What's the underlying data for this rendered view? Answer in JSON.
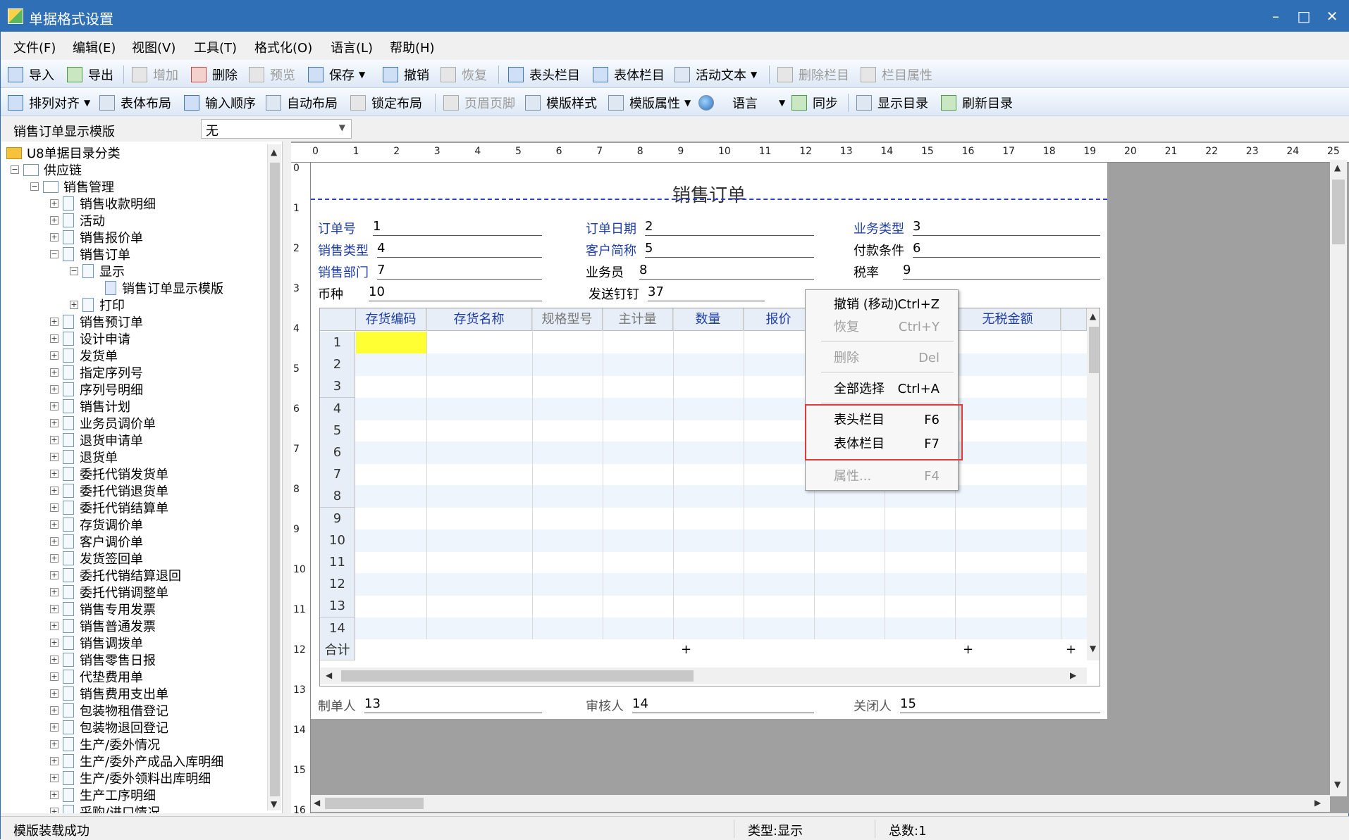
{
  "window": {
    "title": "单据格式设置",
    "minimize": "–",
    "maximize": "□",
    "close": "✕"
  },
  "menu": [
    "文件(F)",
    "编辑(E)",
    "视图(V)",
    "工具(T)",
    "格式化(O)",
    "语言(L)",
    "帮助(H)"
  ],
  "toolbar1": {
    "import": "导入",
    "export": "导出",
    "add": "增加",
    "delete": "删除",
    "preview": "预览",
    "save": "保存",
    "undo": "撤销",
    "redo": "恢复",
    "header_col": "表头栏目",
    "body_col": "表体栏目",
    "active_text": "活动文本",
    "delete_col": "删除栏目",
    "col_props": "栏目属性"
  },
  "toolbar2": {
    "align": "排列对齐",
    "body_layout": "表体布局",
    "input_order": "输入顺序",
    "auto_layout": "自动布局",
    "lock_layout": "锁定布局",
    "header_footer": "页眉页脚",
    "template_style": "模版样式",
    "template_props": "模版属性",
    "language": "语言",
    "sync": "同步",
    "show_dir": "显示目录",
    "refresh_dir": "刷新目录"
  },
  "template": {
    "label": "销售订单显示模版",
    "selected": "无"
  },
  "tree": {
    "root": "U8单据目录分类",
    "supply_chain": "供应链",
    "sales_mgmt": "销售管理",
    "items_before": [
      "销售收款明细",
      "活动",
      "销售报价单"
    ],
    "sales_order": "销售订单",
    "display": "显示",
    "template_node": "销售订单显示模版",
    "print": "打印",
    "items_after": [
      "销售预订单",
      "设计申请",
      "发货单",
      "指定序列号",
      "序列号明细",
      "销售计划",
      "业务员调价单",
      "退货申请单",
      "退货单",
      "委托代销发货单",
      "委托代销退货单",
      "委托代销结算单",
      "存货调价单",
      "客户调价单",
      "发货签回单",
      "委托代销结算退回",
      "委托代销调整单",
      "销售专用发票",
      "销售普通发票",
      "销售调拨单",
      "销售零售日报",
      "代垫费用单",
      "销售费用支出单",
      "包装物租借登记",
      "包装物退回登记",
      "生产/委外情况",
      "生产/委外产成品入库明细",
      "生产/委外领料出库明细",
      "生产工序明细",
      "采购/进口情况"
    ]
  },
  "ruler": {
    "h": [
      "0",
      "1",
      "2",
      "3",
      "4",
      "5",
      "6",
      "7",
      "8",
      "9",
      "10",
      "11",
      "12",
      "13",
      "14",
      "15",
      "16",
      "17",
      "18",
      "19",
      "20",
      "21",
      "22",
      "23",
      "24",
      "25"
    ],
    "v": [
      "0",
      "1",
      "2",
      "3",
      "4",
      "5",
      "6",
      "7",
      "8",
      "9",
      "10",
      "11",
      "12",
      "13",
      "14",
      "15",
      "16"
    ]
  },
  "form": {
    "title": "销售订单",
    "fields": {
      "order_no": {
        "label": "订单号",
        "value": "1"
      },
      "order_date": {
        "label": "订单日期",
        "value": "2"
      },
      "biz_type": {
        "label": "业务类型",
        "value": "3"
      },
      "sales_type": {
        "label": "销售类型",
        "value": "4"
      },
      "customer": {
        "label": "客户简称",
        "value": "5"
      },
      "payment": {
        "label": "付款条件",
        "value": "6"
      },
      "dept": {
        "label": "销售部门",
        "value": "7"
      },
      "salesman": {
        "label": "业务员",
        "value": "8"
      },
      "tax_rate": {
        "label": "税率",
        "value": "9"
      },
      "currency": {
        "label": "币种",
        "value": "10"
      },
      "ship_pin": {
        "label": "发送钉钉",
        "value": "37"
      },
      "maker": {
        "label": "制单人",
        "value": "13"
      },
      "auditor": {
        "label": "审核人",
        "value": "14"
      },
      "closer": {
        "label": "关闭人",
        "value": "15"
      }
    }
  },
  "grid": {
    "columns": [
      "存货编码",
      "存货名称",
      "规格型号",
      "主计量",
      "数量",
      "报价",
      "",
      "",
      "无税金额"
    ],
    "rows": [
      "1",
      "2",
      "3",
      "4",
      "5",
      "6",
      "7",
      "8",
      "9",
      "10",
      "11",
      "12",
      "13",
      "14"
    ],
    "total_label": "合计",
    "plus": "+"
  },
  "context_menu": {
    "undo": {
      "label": "撤销 (移动)",
      "key": "Ctrl+Z"
    },
    "redo": {
      "label": "恢复",
      "key": "Ctrl+Y"
    },
    "delete": {
      "label": "删除",
      "key": "Del"
    },
    "select_all": {
      "label": "全部选择",
      "key": "Ctrl+A"
    },
    "header_col": {
      "label": "表头栏目",
      "key": "F6"
    },
    "body_col": {
      "label": "表体栏目",
      "key": "F7"
    },
    "props": {
      "label": "属性...",
      "key": "F4"
    }
  },
  "status": {
    "message": "模版装载成功",
    "type": "类型:显示",
    "total": "总数:1"
  },
  "colors": {
    "title_bar": "#2e6fb5",
    "highlight_box": "#e03a3a",
    "selected_cell": "#ffff33",
    "label_blue": "#1f3ea8"
  }
}
